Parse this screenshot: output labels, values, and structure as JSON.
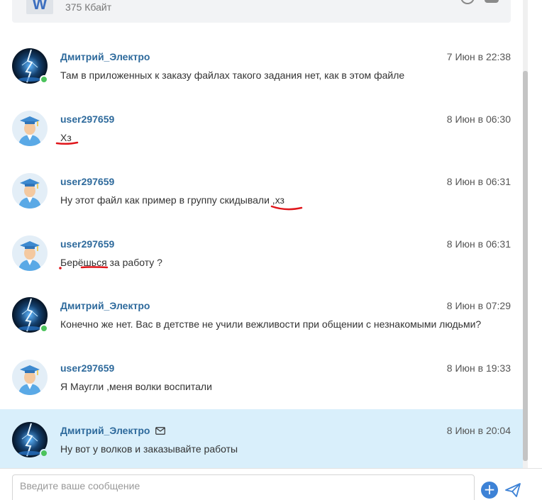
{
  "attachment": {
    "icon": "word-file-icon",
    "icon_letter": "W",
    "size": "375 Кбайт"
  },
  "messages": [
    {
      "author": "Дмитрий_Электро",
      "time": "7 Июн в 22:38",
      "text": "Там в приложенных к заказу файлах такого задания нет, как в этом файле",
      "avatar": "lightning-avatar",
      "online": true
    },
    {
      "author": "user297659",
      "time": "8 Июн в 06:30",
      "text": "Хз",
      "avatar": "graduate-avatar",
      "online": false
    },
    {
      "author": "user297659",
      "time": "8 Июн в 06:31",
      "text": "Ну этот файл как пример в группу скидывали ,хз",
      "avatar": "graduate-avatar",
      "online": false
    },
    {
      "author": "user297659",
      "time": "8 Июн в 06:31",
      "text": "Берёшься за работу ?",
      "avatar": "graduate-avatar",
      "online": false
    },
    {
      "author": "Дмитрий_Электро",
      "time": "8 Июн в 07:29",
      "text": "Конечно же нет. Вас в детстве не учили вежливости при общении с незнакомыми людьми?",
      "avatar": "lightning-avatar",
      "online": true
    },
    {
      "author": "user297659",
      "time": "8 Июн в 19:33",
      "text": "Я Маугли ,меня волки воспитали",
      "avatar": "graduate-avatar",
      "online": false
    },
    {
      "author": "Дмитрий_Электро",
      "time": "8 Июн в 20:04",
      "text": "Ну вот у волков и заказывайте работы",
      "avatar": "lightning-avatar",
      "online": true,
      "highlighted": true,
      "mail_icon": "envelope-icon"
    }
  ],
  "composer": {
    "placeholder": "Введите ваше сообщение"
  },
  "colors": {
    "author": "#2e6a9c",
    "online": "#4cc35c",
    "highlight": "#d9effb",
    "annotation": "#e0161b",
    "accent": "#3d82d6"
  }
}
